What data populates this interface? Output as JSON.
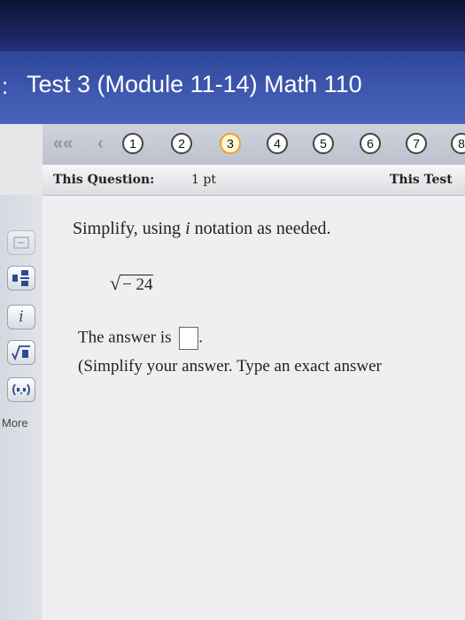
{
  "window": {
    "title_prefix": ":",
    "title": "Test 3 (Module 11-14) Math 110"
  },
  "nav": {
    "first_icon": "double-chevron-left-icon",
    "prev_icon": "chevron-left-icon",
    "questions": [
      "1",
      "2",
      "3",
      "4",
      "5",
      "6",
      "7",
      "8"
    ],
    "current": "3"
  },
  "question_header": {
    "label": "This Question:",
    "points": "1 pt",
    "right_label": "This Test"
  },
  "toolbar": {
    "tools": [
      "fraction-icon",
      "mixed-number-icon",
      "imaginary-i-icon",
      "nth-root-icon",
      "interval-icon"
    ],
    "more_label": "More"
  },
  "question": {
    "prompt_before": "Simplify, using ",
    "prompt_italic": "i",
    "prompt_after": " notation as needed.",
    "radicand": "− 24",
    "answer_prefix": "The answer is",
    "answer_value": "",
    "answer_suffix": ".",
    "hint": "(Simplify your answer. Type an exact answer"
  },
  "colors": {
    "title_bar": "#3e58b0",
    "current_question_ring": "#f0a21c"
  }
}
